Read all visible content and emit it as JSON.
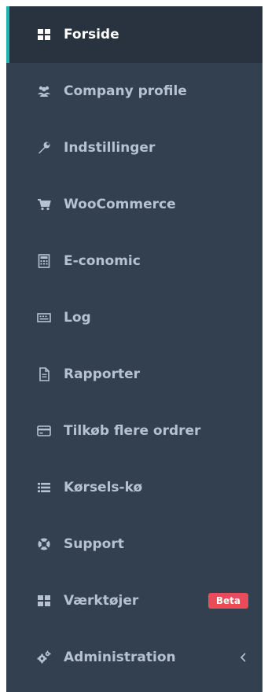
{
  "colors": {
    "sidebar_bg": "#324050",
    "active_bg": "#28333f",
    "active_accent": "#1fb5ac",
    "text": "#b6c2cf",
    "active_text": "#ffffff",
    "badge_bg": "#e84c5a"
  },
  "sidebar": {
    "items": [
      {
        "label": "Forside",
        "icon": "grid-icon",
        "active": true
      },
      {
        "label": "Company profile",
        "icon": "users-icon"
      },
      {
        "label": "Indstillinger",
        "icon": "wrench-icon"
      },
      {
        "label": "WooCommerce",
        "icon": "cart-icon"
      },
      {
        "label": "E-conomic",
        "icon": "calculator-icon"
      },
      {
        "label": "Log",
        "icon": "keyboard-icon"
      },
      {
        "label": "Rapporter",
        "icon": "document-icon"
      },
      {
        "label": "Tilkøb flere ordrer",
        "icon": "credit-card-icon"
      },
      {
        "label": "Kørsels-kø",
        "icon": "list-icon"
      },
      {
        "label": "Support",
        "icon": "lifebuoy-icon"
      },
      {
        "label": "Værktøjer",
        "icon": "grid-icon",
        "badge": "Beta"
      },
      {
        "label": "Administration",
        "icon": "gears-icon",
        "chevron": "chevron-left-icon"
      }
    ]
  }
}
